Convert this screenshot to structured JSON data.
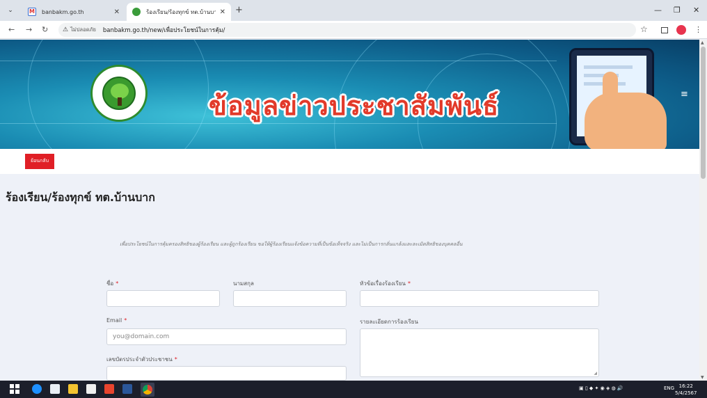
{
  "browser": {
    "tabs": [
      {
        "title": "banbakm.go.th",
        "active": false
      },
      {
        "title": "ร้องเรียน/ร้องทุกข์ ทต.บ้านบาก",
        "active": true
      }
    ],
    "address": {
      "security_label": "ไม่ปลอดภัย",
      "url": "banbakm.go.th/new/เพื่อประโยชน์ในการคุ้ม/"
    }
  },
  "banner": {
    "headline": "ข้อมูลข่าวประชาสัมพันธ์",
    "menu_icon": "≡"
  },
  "page": {
    "back_label": "ย้อนกลับ",
    "title": "ร้องเรียน/ร้องทุกข์ ทต.บ้านบาก",
    "intro": "เพื่อประโยชน์ในการคุ้มครองสิทธิของผู้ร้องเรียน และผู้ถูกร้องเรียน ขอให้ผู้ร้องเรียนแจ้งข้อความที่เป็นข้อเท็จจริง และไม่เป็นการกลั่นแกล้งและละเมิดสิทธิของบุคคลอื่น"
  },
  "form": {
    "first_name_label": "ชื่อ",
    "last_name_label": "นามสกุล",
    "subject_label": "หัวข้อเรื่องร้องเรียน",
    "email_label": "Email",
    "email_placeholder": "you@domain.com",
    "details_label": "รายละเอียดการร้องเรียน",
    "id_card_label": "เลขบัตรประจำตัวประชาชน",
    "required_mark": "*"
  },
  "taskbar": {
    "lang": "ENG",
    "time": "16:22",
    "date": "5/4/2567"
  },
  "colors": {
    "accent_red": "#e01f26",
    "headline_red": "#e23a2a",
    "page_bg": "#eef1f8"
  }
}
